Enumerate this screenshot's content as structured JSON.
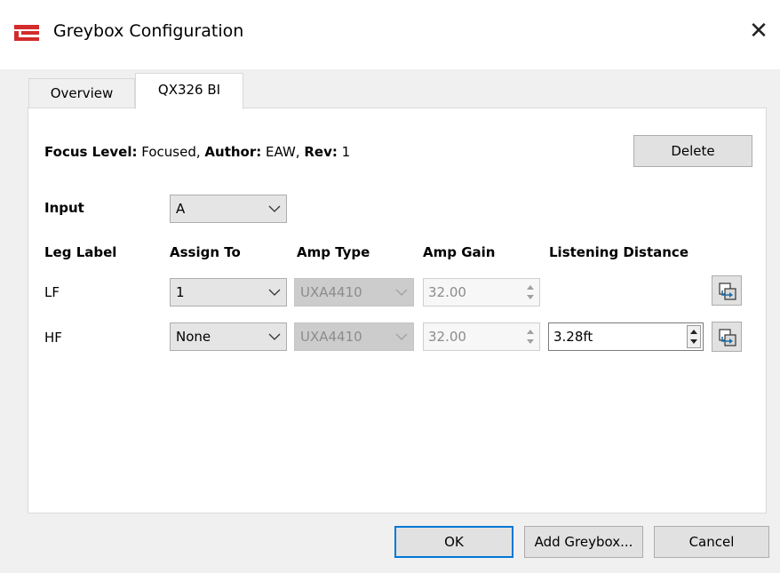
{
  "window": {
    "title": "Greybox Configuration",
    "close_glyph": "✕"
  },
  "tabs": [
    {
      "label": "Overview",
      "active": false
    },
    {
      "label": "QX326 BI",
      "active": true
    }
  ],
  "info": {
    "focus_label": "Focus Level:",
    "focus_value": "Focused,",
    "author_label": "Author:",
    "author_value": "EAW,",
    "rev_label": "Rev:",
    "rev_value": "1"
  },
  "delete_label": "Delete",
  "input": {
    "label": "Input",
    "value": "A"
  },
  "columns": {
    "leg": "Leg Label",
    "assign": "Assign To",
    "amp_type": "Amp Type",
    "amp_gain": "Amp Gain",
    "distance": "Listening Distance"
  },
  "rows": [
    {
      "leg": "LF",
      "assign": "1",
      "amp_type": "UXA4410",
      "amp_gain": "32.00",
      "distance": ""
    },
    {
      "leg": "HF",
      "assign": "None",
      "amp_type": "UXA4410",
      "amp_gain": "32.00",
      "distance": "3.28ft"
    }
  ],
  "footer": {
    "ok": "OK",
    "add": "Add Greybox...",
    "cancel": "Cancel"
  },
  "colors": {
    "accent": "#0078d7",
    "brand": "#d42b2b"
  },
  "icons": {
    "logo": "greybox-logo-icon",
    "close": "close-icon",
    "link": "link-copy-icon"
  }
}
